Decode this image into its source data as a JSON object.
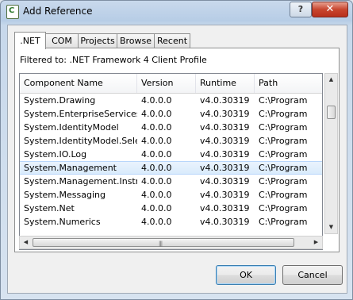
{
  "window": {
    "title": "Add Reference",
    "help_label": "?",
    "close_label": "✕"
  },
  "tabs": [
    {
      "label": ".NET",
      "active": true
    },
    {
      "label": "COM",
      "active": false
    },
    {
      "label": "Projects",
      "active": false
    },
    {
      "label": "Browse",
      "active": false
    },
    {
      "label": "Recent",
      "active": false
    }
  ],
  "filter_text": "Filtered to: .NET Framework 4 Client Profile",
  "columns": [
    "Component Name",
    "Version",
    "Runtime",
    "Path"
  ],
  "rows": [
    {
      "name": "System.Drawing",
      "version": "4.0.0.0",
      "runtime": "v4.0.30319",
      "path": "C:\\Program"
    },
    {
      "name": "System.EnterpriseServices",
      "version": "4.0.0.0",
      "runtime": "v4.0.30319",
      "path": "C:\\Program"
    },
    {
      "name": "System.IdentityModel",
      "version": "4.0.0.0",
      "runtime": "v4.0.30319",
      "path": "C:\\Program"
    },
    {
      "name": "System.IdentityModel.Sele...",
      "version": "4.0.0.0",
      "runtime": "v4.0.30319",
      "path": "C:\\Program"
    },
    {
      "name": "System.IO.Log",
      "version": "4.0.0.0",
      "runtime": "v4.0.30319",
      "path": "C:\\Program"
    },
    {
      "name": "System.Management",
      "version": "4.0.0.0",
      "runtime": "v4.0.30319",
      "path": "C:\\Program",
      "selected": true
    },
    {
      "name": "System.Management.Instr...",
      "version": "4.0.0.0",
      "runtime": "v4.0.30319",
      "path": "C:\\Program"
    },
    {
      "name": "System.Messaging",
      "version": "4.0.0.0",
      "runtime": "v4.0.30319",
      "path": "C:\\Program"
    },
    {
      "name": "System.Net",
      "version": "4.0.0.0",
      "runtime": "v4.0.30319",
      "path": "C:\\Program"
    },
    {
      "name": "System.Numerics",
      "version": "4.0.0.0",
      "runtime": "v4.0.30319",
      "path": "C:\\Program"
    }
  ],
  "buttons": {
    "ok": "OK",
    "cancel": "Cancel"
  },
  "icons": {
    "up_arrow": "▲",
    "down_arrow": "▼",
    "left_arrow": "◀",
    "right_arrow": "▶",
    "grip": "|||"
  },
  "colors": {
    "selection": "#d9ebfc",
    "title_bar": "#b7cde6",
    "close_button": "#c8452e"
  }
}
